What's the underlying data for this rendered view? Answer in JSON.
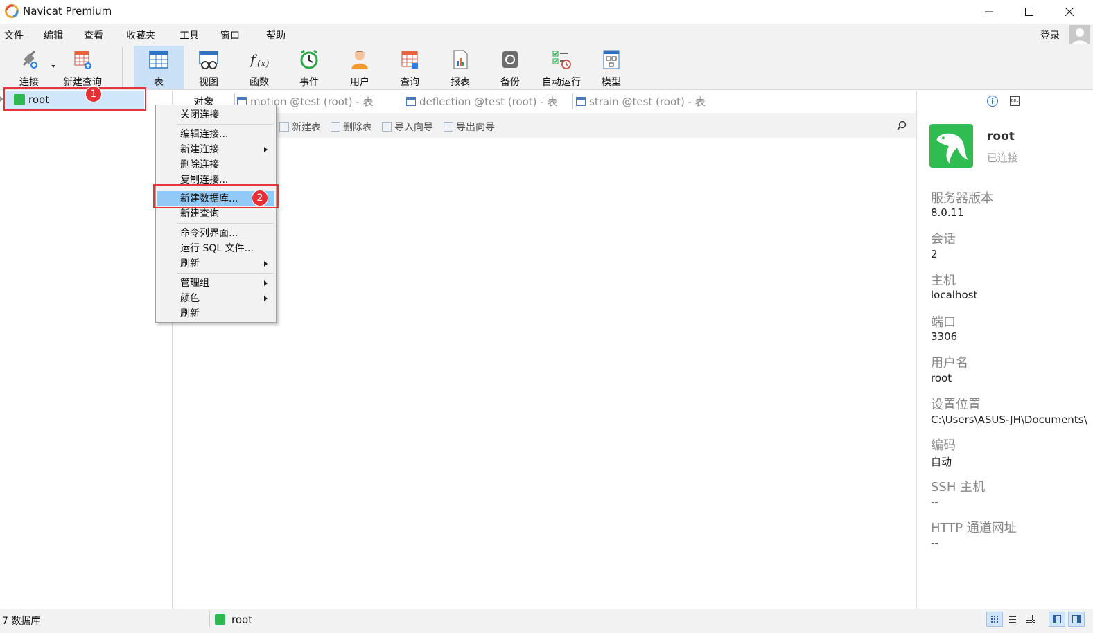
{
  "window": {
    "title": "Navicat Premium"
  },
  "menubar": {
    "items": [
      "文件",
      "编辑",
      "查看",
      "收藏夹",
      "工具",
      "窗口",
      "帮助"
    ],
    "login": "登录"
  },
  "toolbar": {
    "connect": "连接",
    "new_query": "新建查询",
    "table": "表",
    "view": "视图",
    "function": "函数",
    "event": "事件",
    "user": "用户",
    "query": "查询",
    "report": "报表",
    "backup": "备份",
    "automation": "自动运行",
    "model": "模型"
  },
  "navigator": {
    "connection_name": "root",
    "badge": "1"
  },
  "tabs": {
    "objects": "对象",
    "open_tabs": [
      "motion @test (root) - 表",
      "deflection @test (root) - 表",
      "strain @test (root) - 表"
    ]
  },
  "objbar": {
    "new_table": "新建表",
    "delete_table": "删除表",
    "import_wizard": "导入向导",
    "export_wizard": "导出向导"
  },
  "context_menu": {
    "badge": "2",
    "items": [
      "关闭连接",
      "编辑连接...",
      "新建连接",
      "删除连接",
      "复制连接...",
      "新建数据库...",
      "新建查询",
      "命令列界面...",
      "运行 SQL 文件...",
      "刷新",
      "管理组",
      "颜色",
      "刷新"
    ]
  },
  "info": {
    "name": "root",
    "status": "已连接",
    "ddl_icon_text": "DDL",
    "props": [
      {
        "label": "服务器版本",
        "value": "8.0.11"
      },
      {
        "label": "会话",
        "value": "2"
      },
      {
        "label": "主机",
        "value": "localhost"
      },
      {
        "label": "端口",
        "value": "3306"
      },
      {
        "label": "用户名",
        "value": "root"
      },
      {
        "label": "设置位置",
        "value": "C:\\Users\\ASUS-JH\\Documents\\"
      },
      {
        "label": "编码",
        "value": "自动"
      },
      {
        "label": "SSH 主机",
        "value": "--"
      },
      {
        "label": "HTTP 通道网址",
        "value": "--"
      }
    ]
  },
  "statusbar": {
    "db_count": "7 数据库",
    "connection": "root"
  },
  "colors": {
    "selection": "#cfe6fb",
    "menu_highlight": "#91c9f7",
    "annotation_red": "#e5343a",
    "mysql_green": "#2fbd52"
  }
}
